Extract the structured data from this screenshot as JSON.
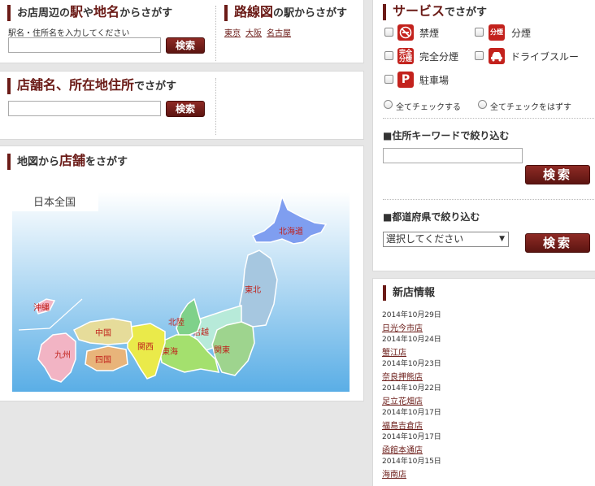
{
  "station_search": {
    "title_parts": [
      "お店周辺の",
      "駅",
      "や",
      "地名",
      "からさがす"
    ],
    "input_label": "駅名・住所名を入力してください",
    "input_value": "",
    "button": "検索"
  },
  "line_search": {
    "title_parts": [
      "路線図",
      "の駅からさがす"
    ],
    "links": [
      "東京",
      "大阪",
      "名古屋"
    ]
  },
  "name_search": {
    "title_parts": [
      "店舗名、所在地住所",
      "でさがす"
    ],
    "input_value": "",
    "button": "検索"
  },
  "map_search": {
    "title_parts": [
      "地図から",
      "店舗",
      "をさがす"
    ],
    "all_japan": "日本全国",
    "regions": [
      "北海道",
      "東北",
      "関東",
      "甲信越",
      "北陸",
      "東海",
      "関西",
      "中国",
      "四国",
      "九州",
      "沖縄"
    ]
  },
  "service": {
    "title_parts": [
      "サービス",
      "でさがす"
    ],
    "items": [
      {
        "label": "禁煙",
        "icon": "no-smoking-icon",
        "icon_text": "",
        "checked": false
      },
      {
        "label": "分煙",
        "icon": "separate-smoking-icon",
        "icon_text": "分煙",
        "checked": false
      },
      {
        "label": "完全分煙",
        "icon": "full-separate-smoking-icon",
        "icon_text": "完全分煙",
        "checked": false
      },
      {
        "label": "ドライブスルー",
        "icon": "drive-thru-icon",
        "icon_text": "",
        "checked": false
      },
      {
        "label": "駐車場",
        "icon": "parking-icon",
        "icon_text": "P",
        "checked": false
      }
    ],
    "check_all": "全てチェックする",
    "uncheck_all": "全てチェックをはずす",
    "icon_color": "#c3221d"
  },
  "keyword": {
    "title": "■住所キーワードで絞り込む",
    "input_value": "",
    "button": "検索"
  },
  "prefecture": {
    "title": "■都道府県で絞り込む",
    "selected": "選択してください",
    "button": "検索"
  },
  "news": {
    "title": "新店情報",
    "items": [
      {
        "date": "2014年10月29日",
        "name": "日光今市店"
      },
      {
        "date": "2014年10月24日",
        "name": "蟹江店"
      },
      {
        "date": "2014年10月23日",
        "name": "奈良押熊店"
      },
      {
        "date": "2014年10月22日",
        "name": "足立花畑店"
      },
      {
        "date": "2014年10月17日",
        "name": "福島吉倉店"
      },
      {
        "date": "2014年10月17日",
        "name": "函館本通店"
      },
      {
        "date": "2014年10月15日",
        "name": "海南店"
      }
    ]
  },
  "colors": {
    "accent": "#6b1b17",
    "button": "#7a201b",
    "hokkaido": "#7f9ef0",
    "tohoku": "#a6c7e0",
    "kanto": "#9ed48e",
    "koshinetsu": "#b7ead9",
    "hokuriku": "#7fd18a",
    "tokai": "#a4e06e",
    "kansai": "#eaea4a",
    "chugoku": "#e6dc9a",
    "shikoku": "#e8b47a",
    "kyushu": "#f2b4c4",
    "okinawa": "#f2b4c4"
  }
}
